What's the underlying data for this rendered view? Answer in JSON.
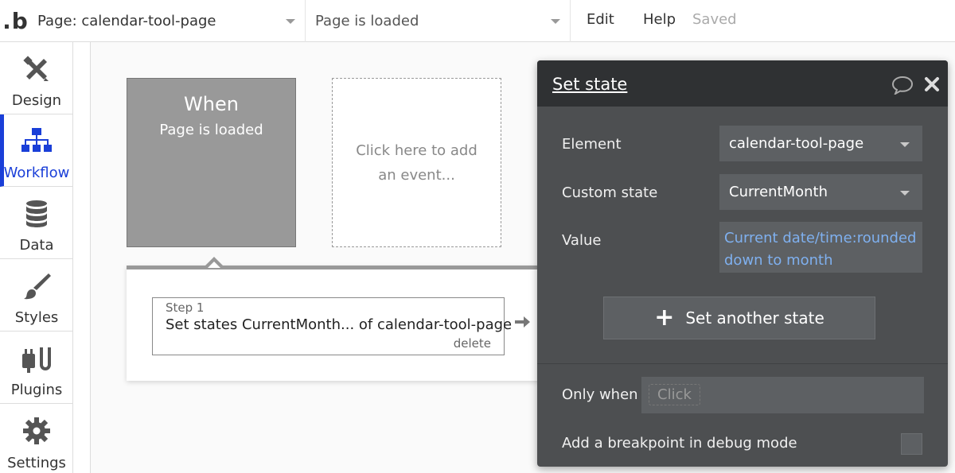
{
  "topbar": {
    "logo": "b",
    "page_dropdown": "Page: calendar-tool-page",
    "event_dropdown": "Page is loaded",
    "menu": {
      "edit": "Edit",
      "help": "Help",
      "saved": "Saved"
    }
  },
  "sidebar": {
    "items": [
      {
        "label": "Design",
        "icon": "design-icon"
      },
      {
        "label": "Workflow",
        "icon": "workflow-icon",
        "active": true
      },
      {
        "label": "Data",
        "icon": "data-icon"
      },
      {
        "label": "Styles",
        "icon": "styles-icon"
      },
      {
        "label": "Plugins",
        "icon": "plugins-icon"
      },
      {
        "label": "Settings",
        "icon": "gear-icon"
      }
    ]
  },
  "canvas": {
    "when_card": {
      "title": "When",
      "subtitle": "Page is loaded"
    },
    "add_event": "Click here to add an event...",
    "step": {
      "number": "Step 1",
      "text": "Set states CurrentMonth... of calendar-tool-page",
      "delete": "delete"
    }
  },
  "dialog": {
    "title": "Set state",
    "element_label": "Element",
    "element_value": "calendar-tool-page",
    "custom_state_label": "Custom state",
    "custom_state_value": "CurrentMonth",
    "value_label": "Value",
    "value_expression": "Current date/time:rounded down to month",
    "set_another": "Set another state",
    "only_when_label": "Only when",
    "only_when_placeholder": "Click",
    "breakpoint_label": "Add a breakpoint in debug mode"
  },
  "colors": {
    "accent": "#1a3fd8",
    "dialog_bg": "#4d4f51",
    "dialog_header": "#2f3133",
    "expression_text": "#7fb0ef"
  }
}
